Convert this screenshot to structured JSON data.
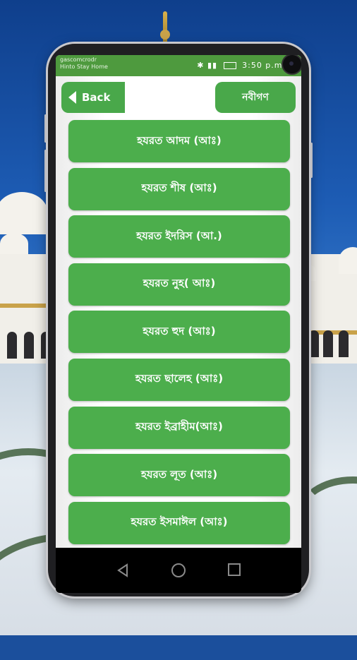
{
  "status_bar": {
    "left_lines": [
      "gascomcrodr",
      "Hinto Stay Home"
    ],
    "right_text": "3:50 p.m."
  },
  "header": {
    "back_label": "Back",
    "title": "নবীগণ"
  },
  "prophets": [
    "হযরত আদম (আঃ)",
    "হযরত শীষ (আঃ)",
    "হযরত ইদরিস (আ.)",
    "হযরত নুহ( আঃ)",
    "হযরত হুদ (আঃ)",
    "হযরত ছালেহ (আঃ)",
    "হযরত ইব্রাহীম(আঃ)",
    "হযরত লূত (আঃ)",
    "হযরত ইসমাঈল (আঃ)"
  ],
  "nav_icons": [
    "back-triangle-icon",
    "home-circle-icon",
    "recent-square-icon"
  ],
  "colors": {
    "primary_green": "#4cae4c",
    "status_green": "#4e9a3e",
    "navbar": "#000000"
  }
}
